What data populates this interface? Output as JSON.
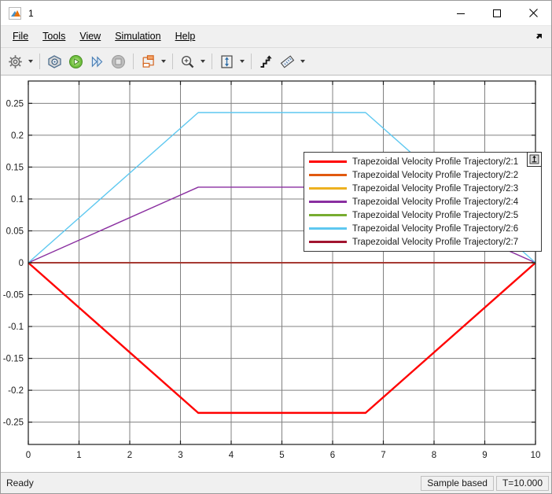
{
  "window": {
    "title": "1",
    "icon": "matlab-logo-icon",
    "controls": [
      {
        "name": "minimize",
        "glyph": "minimize-icon"
      },
      {
        "name": "maximize",
        "glyph": "maximize-icon"
      },
      {
        "name": "close",
        "glyph": "close-icon"
      }
    ]
  },
  "menubar": {
    "items": [
      {
        "label": "File",
        "mnemonic": "F"
      },
      {
        "label": "Tools",
        "mnemonic": "T"
      },
      {
        "label": "View",
        "mnemonic": "V"
      },
      {
        "label": "Simulation",
        "mnemonic": "i"
      },
      {
        "label": "Help",
        "mnemonic": "H"
      }
    ],
    "expand_icon": "expand-arrow-icon"
  },
  "toolbar": {
    "buttons": [
      {
        "name": "configuration-properties-button",
        "icon": "gear-icon",
        "has_caret": true
      },
      {
        "name": "print-button",
        "icon": "print-icon",
        "has_caret": false
      },
      {
        "name": "run-button",
        "icon": "play-icon",
        "has_caret": false
      },
      {
        "name": "step-forward-button",
        "icon": "step-forward-icon",
        "has_caret": false
      },
      {
        "name": "stop-button",
        "icon": "stop-icon",
        "has_caret": false
      },
      {
        "name": "signal-selection-button",
        "icon": "signal-blocks-icon",
        "has_caret": true
      },
      {
        "name": "zoom-button",
        "icon": "magnifier-plus-icon",
        "has_caret": true
      },
      {
        "name": "autoscale-button",
        "icon": "fit-to-view-icon",
        "has_caret": true
      },
      {
        "name": "data-cursors-button",
        "icon": "stairs-arrow-icon",
        "has_caret": false
      },
      {
        "name": "measurements-button",
        "icon": "ruler-icon",
        "has_caret": true
      }
    ]
  },
  "legend": {
    "pin_icon": "pin-icon",
    "entries": [
      {
        "label": "Trapezoidal Velocity Profile Trajectory/2:1",
        "color": "#ff0000"
      },
      {
        "label": "Trapezoidal Velocity Profile Trajectory/2:2",
        "color": "#e1590f"
      },
      {
        "label": "Trapezoidal Velocity Profile Trajectory/2:3",
        "color": "#edb120"
      },
      {
        "label": "Trapezoidal Velocity Profile Trajectory/2:4",
        "color": "#8a2fa0"
      },
      {
        "label": "Trapezoidal Velocity Profile Trajectory/2:5",
        "color": "#77ac30"
      },
      {
        "label": "Trapezoidal Velocity Profile Trajectory/2:6",
        "color": "#5ec8f0"
      },
      {
        "label": "Trapezoidal Velocity Profile Trajectory/2:7",
        "color": "#a2142f"
      }
    ]
  },
  "statusbar": {
    "state": "Ready",
    "frame_mode": "Sample based",
    "time": "T=10.000"
  },
  "chart_data": {
    "type": "line",
    "title": "",
    "xlabel": "",
    "ylabel": "",
    "xlim": [
      0,
      10
    ],
    "ylim": [
      -0.285,
      0.285
    ],
    "xticks": [
      0,
      1,
      2,
      3,
      4,
      5,
      6,
      7,
      8,
      9,
      10
    ],
    "yticks": [
      -0.25,
      -0.2,
      -0.15,
      -0.1,
      -0.05,
      0,
      0.05,
      0.1,
      0.15,
      0.2,
      0.25
    ],
    "ytick_labels": [
      "-0.25",
      "-0.2",
      "-0.15",
      "-0.1",
      "-0.05",
      "0",
      "0.05",
      "0.1",
      "0.15",
      "0.2",
      "0.25"
    ],
    "xtick_labels": [
      "0",
      "1",
      "2",
      "3",
      "4",
      "5",
      "6",
      "7",
      "8",
      "9",
      "10"
    ],
    "grid": true,
    "legend_position": "top-right",
    "series": [
      {
        "name": "Trapezoidal Velocity Profile Trajectory/2:1",
        "color": "#ff0000",
        "width": 2.4,
        "x": [
          0,
          3.35,
          6.65,
          10
        ],
        "y": [
          0,
          -0.2355,
          -0.2355,
          0
        ]
      },
      {
        "name": "Trapezoidal Velocity Profile Trajectory/2:2",
        "color": "#e1590f",
        "width": 1.4,
        "x": [
          0,
          10
        ],
        "y": [
          0,
          0
        ]
      },
      {
        "name": "Trapezoidal Velocity Profile Trajectory/2:3",
        "color": "#edb120",
        "width": 1.4,
        "x": [
          0,
          10
        ],
        "y": [
          0,
          0
        ]
      },
      {
        "name": "Trapezoidal Velocity Profile Trajectory/2:4",
        "color": "#8a2fa0",
        "width": 1.4,
        "x": [
          0,
          3.35,
          6.65,
          10
        ],
        "y": [
          0,
          0.1185,
          0.1185,
          0
        ]
      },
      {
        "name": "Trapezoidal Velocity Profile Trajectory/2:5",
        "color": "#77ac30",
        "width": 1.4,
        "x": [
          0,
          10
        ],
        "y": [
          0,
          0
        ]
      },
      {
        "name": "Trapezoidal Velocity Profile Trajectory/2:6",
        "color": "#5ec8f0",
        "width": 1.4,
        "x": [
          0,
          3.35,
          6.65,
          10
        ],
        "y": [
          0,
          0.2355,
          0.2355,
          0
        ]
      },
      {
        "name": "Trapezoidal Velocity Profile Trajectory/2:7",
        "color": "#a2142f",
        "width": 1.4,
        "x": [
          0,
          10
        ],
        "y": [
          0,
          0
        ]
      }
    ]
  }
}
